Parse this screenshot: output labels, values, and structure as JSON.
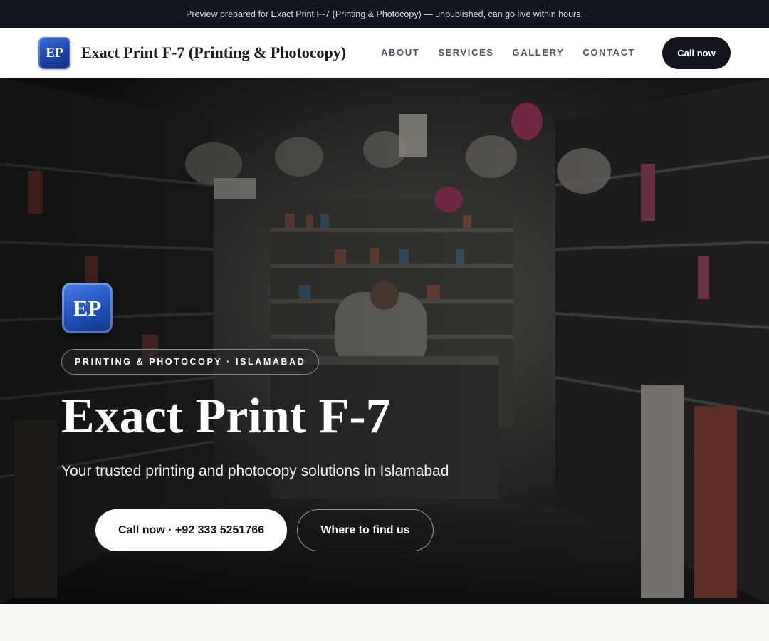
{
  "preview_banner": "Preview prepared for Exact Print F-7 (Printing & Photocopy) — unpublished, can go live within hours.",
  "header": {
    "logo_initials": "EP",
    "brand_name": "Exact Print F-7 (Printing & Photocopy)",
    "nav": [
      "ABOUT",
      "SERVICES",
      "GALLERY",
      "CONTACT"
    ],
    "cta_label": "Call now"
  },
  "hero": {
    "logo_initials": "EP",
    "eyebrow": "PRINTING & PHOTOCOPY · ISLAMABAD",
    "title": "Exact Print F-7",
    "subtitle": "Your trusted printing and photocopy solutions in Islamabad",
    "primary_button": "Call now · +92 333 5251766",
    "secondary_button": "Where to find us"
  },
  "colors": {
    "topbar_bg": "#12151d",
    "accent_blue": "#2150b8",
    "cta_dark": "#12151d"
  }
}
